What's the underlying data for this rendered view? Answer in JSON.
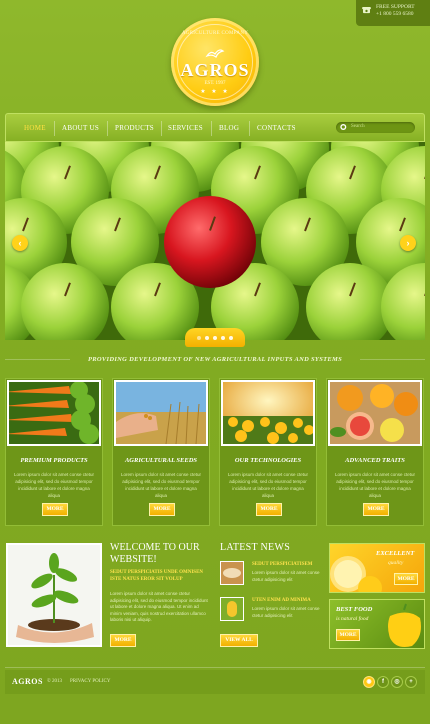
{
  "support": {
    "label": "FREE SUPPORT",
    "phone": "+1 800 559 6580",
    "icon": "phone-icon"
  },
  "logo": {
    "tagline": "AGRICULTURE COMPANY",
    "name": "AGROS",
    "est": "EST. 1997",
    "stars": "★ ★ ★"
  },
  "nav": {
    "items": [
      {
        "label": "HOME",
        "active": true
      },
      {
        "label": "ABOUT US"
      },
      {
        "label": "PRODUCTS"
      },
      {
        "label": "SERVICES"
      },
      {
        "label": "BLOG"
      },
      {
        "label": "CONTACTS"
      }
    ],
    "search_placeholder": "Search"
  },
  "slider": {
    "prev_icon": "chevron-left-icon",
    "next_icon": "chevron-right-icon",
    "dot_count": 5,
    "active_dot": 1
  },
  "tagline": "PROVIDING DEVELOPMENT OF NEW AGRICULTURAL INPUTS AND SYSTEMS",
  "cards": [
    {
      "title": "PREMIUM PRODUCTS",
      "desc": "Lorem ipsum dolor sit amet conse ctetur adipisicing elit, sed do eiusmod tempor incididunt ut labore et dolore magna aliqua",
      "button": "MORE"
    },
    {
      "title": "AGRICULTURAL SEEDS",
      "desc": "Lorem ipsum dolor sit amet conse ctetur adipisicing elit, sed do eiusmod tempor incididunt ut labore et dolore magna aliqua",
      "button": "MORE"
    },
    {
      "title": "OUR TECHNOLOGIES",
      "desc": "Lorem ipsum dolor sit amet conse ctetur adipisicing elit, sed do eiusmod tempor incididunt ut labore et dolore magna aliqua",
      "button": "MORE"
    },
    {
      "title": "ADVANCED TRAITS",
      "desc": "Lorem ipsum dolor sit amet conse ctetur adipisicing elit, sed do eiusmod tempor incididunt ut labore et dolore magna aliqua",
      "button": "MORE"
    }
  ],
  "welcome": {
    "title": "WELCOME TO OUR WEBSITE!",
    "subtitle": "SEDUT PERSPICIATIS UNDE OMNISEN ISTE NATUS EROR SIT VOLUP",
    "desc": "Lorem ipsum dolor sit amet conse ctetur adipisicing elit, sed do eiusmod tempor incididunt ut labore et dolore magna aliqua. Ut enim ad minim veniam, quis nostrud exercitation ullamco laboris nisi ut aliquip.",
    "button": "MORE"
  },
  "news": {
    "title": "LATEST NEWS",
    "items": [
      {
        "headline": "SEDUT PERSPICIATISEM",
        "text": "Lorem ipsum dolor sit amet conse ctetur adipisicing elit"
      },
      {
        "headline": "UTEN ENIM AD MINIMA",
        "text": "Lorem ipsum dolor sit amet conse ctetur adipisicing elit"
      }
    ],
    "button": "VIEW ALL"
  },
  "promos": [
    {
      "big": "EXCELLENT",
      "small": "quality",
      "button": "MORE"
    },
    {
      "big": "BEST FOOD",
      "small": "is natural food",
      "button": "MORE"
    }
  ],
  "footer": {
    "brand": "AGROS",
    "copyright": "© 2013",
    "policy": "PRIVACY POLICY",
    "social": [
      {
        "icon": "rss-icon",
        "glyph": "◉"
      },
      {
        "icon": "facebook-icon",
        "glyph": "f"
      },
      {
        "icon": "camera-icon",
        "glyph": "◎"
      },
      {
        "icon": "plus-icon",
        "glyph": "+"
      }
    ]
  }
}
